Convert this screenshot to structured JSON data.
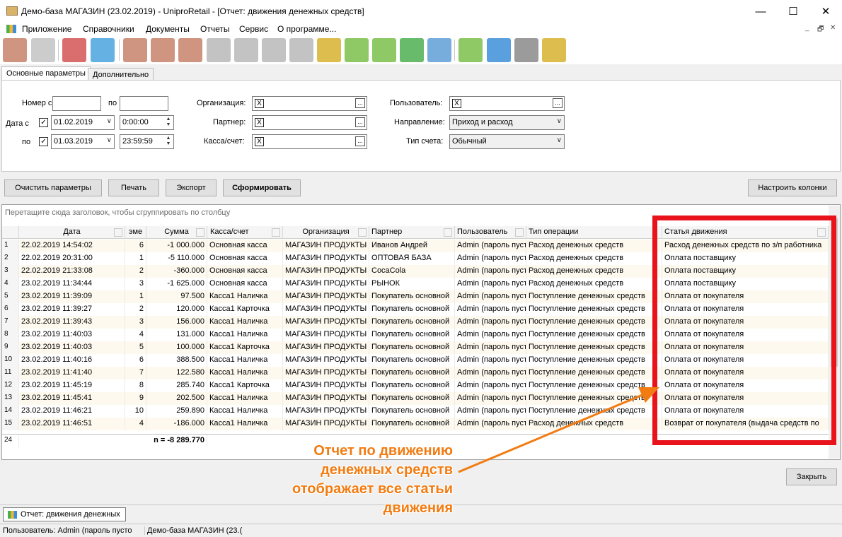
{
  "window": {
    "title": "Демо-база МАГАЗИН (23.02.2019) - UniproRetail  - [Отчет: движения денежных средств]",
    "min": "—",
    "max": "☐",
    "close": "✕"
  },
  "menu": [
    "Приложение",
    "Справочники",
    "Документы",
    "Отчеты",
    "Сервис",
    "О программе..."
  ],
  "mdi_controls": [
    "_",
    "🗗",
    "✕"
  ],
  "toolbar_icons": [
    {
      "name": "exit-icon",
      "color": "#c7826a"
    },
    {
      "name": "lock-icon",
      "color": "#c3c3c3"
    },
    {
      "name": "books-icon",
      "color": "#d35454"
    },
    {
      "name": "users-icon",
      "color": "#4aa3df"
    },
    {
      "name": "doc-star-icon",
      "color": "#c7826a"
    },
    {
      "name": "doc-plus-icon",
      "color": "#c7826a"
    },
    {
      "name": "doc-minus-icon",
      "color": "#c7826a"
    },
    {
      "name": "basket-star-icon",
      "color": "#b8b8b8"
    },
    {
      "name": "basket-plus-icon",
      "color": "#b8b8b8"
    },
    {
      "name": "basket-minus-icon",
      "color": "#b8b8b8"
    },
    {
      "name": "basket-arrow-icon",
      "color": "#b8b8b8"
    },
    {
      "name": "coins-plus-icon",
      "color": "#d8b230"
    },
    {
      "name": "cash-icon",
      "color": "#7bbf4a"
    },
    {
      "name": "money-icon",
      "color": "#7bbf4a"
    },
    {
      "name": "truck-icon",
      "color": "#4caf50"
    },
    {
      "name": "calculator-icon",
      "color": "#5e9fd6"
    },
    {
      "name": "spellcheck-icon",
      "color": "#7bbf4a"
    },
    {
      "name": "export-icon",
      "color": "#3d8ed8"
    },
    {
      "name": "printer-icon",
      "color": "#8a8a8a"
    },
    {
      "name": "scales-icon",
      "color": "#d8b230"
    },
    {
      "name": "upload-icon",
      "color": "#7bbf4a"
    }
  ],
  "tabs": [
    "Основные параметры",
    "Дополнительно"
  ],
  "params": {
    "num_from_label": "Номер с",
    "num_to_label": "по",
    "num_from": "",
    "num_to": "",
    "date_from_label": "Дата с",
    "date_to_label": "по",
    "date_from": "01.02.2019",
    "time_from": "0:00:00",
    "date_to": "01.03.2019",
    "time_to": "23:59:59",
    "org_label": "Организация:",
    "partner_label": "Партнер:",
    "kassa_label": "Касса/счет:",
    "user_label": "Пользователь:",
    "direction_label": "Направление:",
    "acc_type_label": "Тип счета:",
    "direction": "Приход и расход",
    "acc_type": "Обычный",
    "check": "✓",
    "x": "X",
    "ellipsis": "...",
    "dropdown": "∨",
    "spin_up": "▲",
    "spin_down": "▼"
  },
  "buttons": {
    "clear": "Очистить параметры",
    "print": "Печать",
    "export": "Экспорт",
    "generate": "Сформировать",
    "columns": "Настроить колонки",
    "close": "Закрыть"
  },
  "grid": {
    "group_hint": "Перетащите сюда заголовок, чтобы сгруппировать по столбцу",
    "columns": [
      "Дата",
      "эме",
      "Сумма",
      "Касса/счет",
      "Организация",
      "Партнер",
      "Пользователь",
      "Тип операции",
      "Статья движения"
    ],
    "rows": [
      {
        "n": "1",
        "date": "22.02.2019 14:54:02",
        "num": "6",
        "sum": "-1 000.000",
        "kassa": "Основная касса",
        "org": "МАГАЗИН ПРОДУКТЫ",
        "partner": "Иванов Андрей",
        "user": "Admin (пароль пуст",
        "op": "Расход денежных средств",
        "article": "Расход денежных средств по з/п работника"
      },
      {
        "n": "2",
        "date": "22.02.2019 20:31:00",
        "num": "1",
        "sum": "-5 110.000",
        "kassa": "Основная касса",
        "org": "МАГАЗИН ПРОДУКТЫ",
        "partner": "ОПТОВАЯ БАЗА",
        "user": "Admin (пароль пуст",
        "op": "Расход денежных средств",
        "article": "Оплата поставщику"
      },
      {
        "n": "3",
        "date": "22.02.2019 21:33:08",
        "num": "2",
        "sum": "-360.000",
        "kassa": "Основная касса",
        "org": "МАГАЗИН ПРОДУКТЫ",
        "partner": "CocaCola",
        "user": "Admin (пароль пуст",
        "op": "Расход денежных средств",
        "article": "Оплата поставщику"
      },
      {
        "n": "4",
        "date": "23.02.2019 11:34:44",
        "num": "3",
        "sum": "-1 625.000",
        "kassa": "Основная касса",
        "org": "МАГАЗИН ПРОДУКТЫ",
        "partner": "РЫНОК",
        "user": "Admin (пароль пуст",
        "op": "Расход денежных средств",
        "article": "Оплата поставщику"
      },
      {
        "n": "5",
        "date": "23.02.2019 11:39:09",
        "num": "1",
        "sum": "97.500",
        "kassa": "Касса1 Наличка",
        "org": "МАГАЗИН ПРОДУКТЫ",
        "partner": "Покупатель основной",
        "user": "Admin (пароль пуст",
        "op": "Поступление денежных средств",
        "article": "Оплата от покупателя"
      },
      {
        "n": "6",
        "date": "23.02.2019 11:39:27",
        "num": "2",
        "sum": "120.000",
        "kassa": "Касса1 Карточка",
        "org": "МАГАЗИН ПРОДУКТЫ",
        "partner": "Покупатель основной",
        "user": "Admin (пароль пуст",
        "op": "Поступление денежных средств",
        "article": "Оплата от покупателя"
      },
      {
        "n": "7",
        "date": "23.02.2019 11:39:43",
        "num": "3",
        "sum": "156.000",
        "kassa": "Касса1 Наличка",
        "org": "МАГАЗИН ПРОДУКТЫ",
        "partner": "Покупатель основной",
        "user": "Admin (пароль пуст",
        "op": "Поступление денежных средств",
        "article": "Оплата от покупателя"
      },
      {
        "n": "8",
        "date": "23.02.2019 11:40:03",
        "num": "4",
        "sum": "131.000",
        "kassa": "Касса1 Наличка",
        "org": "МАГАЗИН ПРОДУКТЫ",
        "partner": "Покупатель основной",
        "user": "Admin (пароль пуст",
        "op": "Поступление денежных средств",
        "article": "Оплата от покупателя"
      },
      {
        "n": "9",
        "date": "23.02.2019 11:40:03",
        "num": "5",
        "sum": "100.000",
        "kassa": "Касса1 Карточка",
        "org": "МАГАЗИН ПРОДУКТЫ",
        "partner": "Покупатель основной",
        "user": "Admin (пароль пуст",
        "op": "Поступление денежных средств",
        "article": "Оплата от покупателя"
      },
      {
        "n": "10",
        "date": "23.02.2019 11:40:16",
        "num": "6",
        "sum": "388.500",
        "kassa": "Касса1 Наличка",
        "org": "МАГАЗИН ПРОДУКТЫ",
        "partner": "Покупатель основной",
        "user": "Admin (пароль пуст",
        "op": "Поступление денежных средств",
        "article": "Оплата от покупателя"
      },
      {
        "n": "11",
        "date": "23.02.2019 11:41:40",
        "num": "7",
        "sum": "122.580",
        "kassa": "Касса1 Наличка",
        "org": "МАГАЗИН ПРОДУКТЫ",
        "partner": "Покупатель основной",
        "user": "Admin (пароль пуст",
        "op": "Поступление денежных средств",
        "article": "Оплата от покупателя"
      },
      {
        "n": "12",
        "date": "23.02.2019 11:45:19",
        "num": "8",
        "sum": "285.740",
        "kassa": "Касса1 Карточка",
        "org": "МАГАЗИН ПРОДУКТЫ",
        "partner": "Покупатель основной",
        "user": "Admin (пароль пуст",
        "op": "Поступление денежных средств",
        "article": "Оплата от покупателя"
      },
      {
        "n": "13",
        "date": "23.02.2019 11:45:41",
        "num": "9",
        "sum": "202.500",
        "kassa": "Касса1 Наличка",
        "org": "МАГАЗИН ПРОДУКТЫ",
        "partner": "Покупатель основной",
        "user": "Admin (пароль пуст",
        "op": "Поступление денежных средств",
        "article": "Оплата от покупателя"
      },
      {
        "n": "14",
        "date": "23.02.2019 11:46:21",
        "num": "10",
        "sum": "259.890",
        "kassa": "Касса1 Наличка",
        "org": "МАГАЗИН ПРОДУКТЫ",
        "partner": "Покупатель основной",
        "user": "Admin (пароль пуст",
        "op": "Поступление денежных средств",
        "article": "Оплата от покупателя"
      },
      {
        "n": "15",
        "date": "23.02.2019 11:46:51",
        "num": "4",
        "sum": "-186.000",
        "kassa": "Касса1 Наличка",
        "org": "МАГАЗИН ПРОДУКТЫ",
        "partner": "Покупатель основной",
        "user": "Admin (пароль пуст",
        "op": "Расход денежных средств",
        "article": "Возврат от покупателя (выдача средств по"
      }
    ],
    "footer_count": "24",
    "footer_sum": "n = -8 289.770"
  },
  "taskbar_item": "Отчет: движения денежных",
  "status": {
    "user": "Пользователь: Admin (пароль пусто",
    "db": "Демо-база МАГАЗИН (23.("
  },
  "annotation": {
    "lines": [
      "Отчет по движению",
      "денежных средств",
      "отображает все статьи",
      "движения"
    ],
    "color": "#f27c12",
    "box_color": "#e8131b"
  }
}
